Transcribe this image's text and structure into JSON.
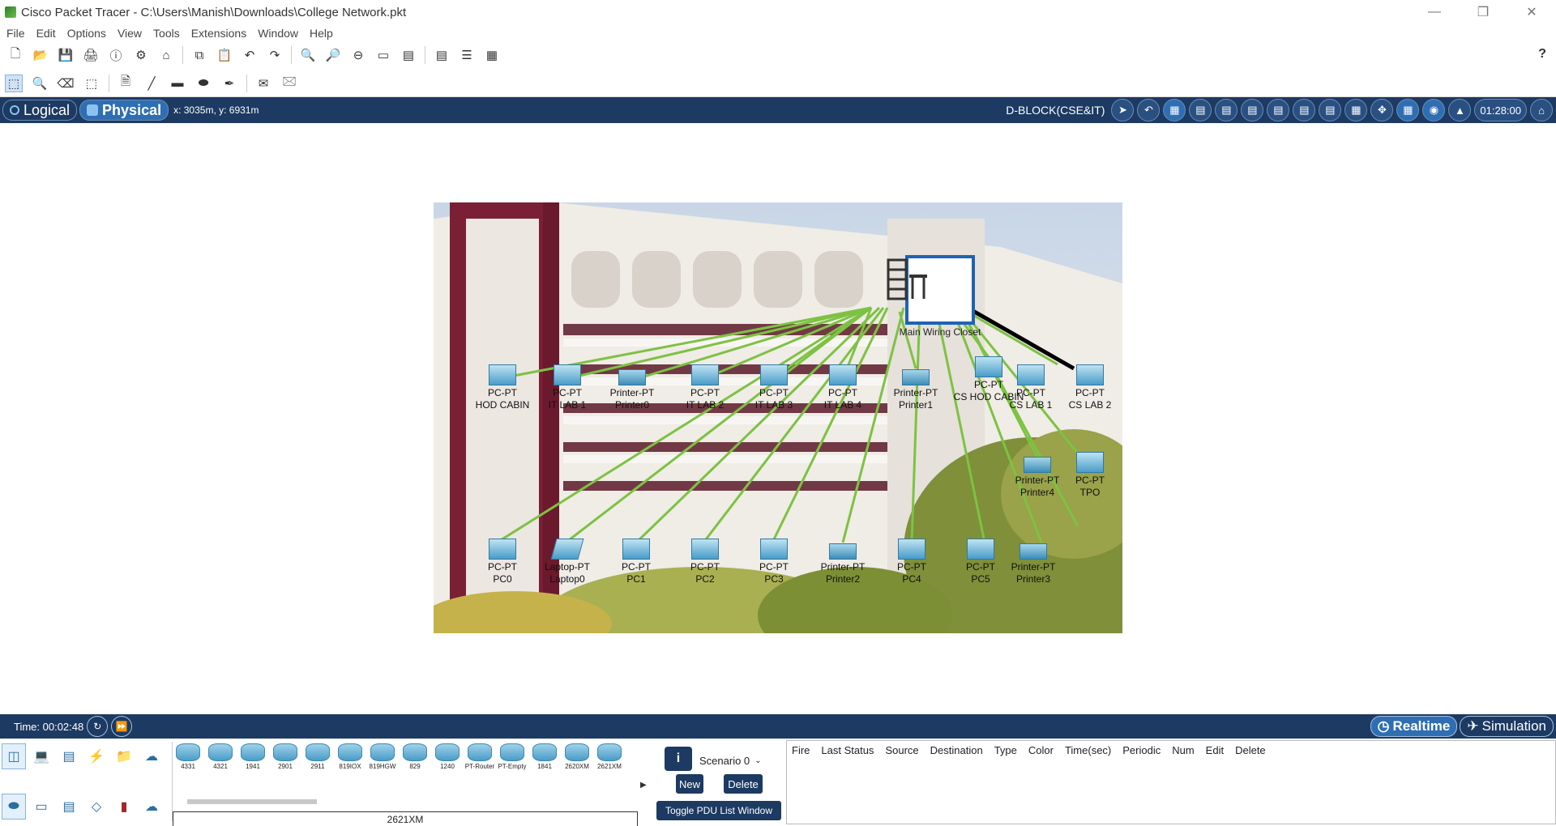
{
  "window": {
    "title": "Cisco Packet Tracer - C:\\Users\\Manish\\Downloads\\College Network.pkt"
  },
  "menu": [
    "File",
    "Edit",
    "Options",
    "View",
    "Tools",
    "Extensions",
    "Window",
    "Help"
  ],
  "toolbar_main": {
    "icons": [
      "new-file-icon",
      "open-icon",
      "save-icon",
      "print-icon",
      "info-icon",
      "wizard-icon",
      "network-info-icon",
      "copy-icon",
      "paste-icon",
      "undo-icon",
      "redo-icon",
      "zoom-in-icon",
      "zoom-reset-icon",
      "zoom-out-icon",
      "drawing-palette-icon",
      "custom-device-icon",
      "notes-icon",
      "cluster-icon",
      "viewport-icon"
    ],
    "help": "?"
  },
  "toolbar_tools": {
    "icons": [
      "select-icon",
      "inspect-icon",
      "delete-icon",
      "resize-icon",
      "note-icon",
      "line-icon",
      "rectangle-icon",
      "ellipse-icon",
      "freeform-icon",
      "add-simple-pdu-icon",
      "add-complex-pdu-icon"
    ]
  },
  "modebar": {
    "logical": "Logical",
    "physical": "Physical",
    "coords": "x: 3035m, y: 6931m",
    "location": "D-BLOCK(CSE&IT)",
    "clock": "01:28:00"
  },
  "canvas": {
    "closet_label": "Main Wiring Closet",
    "devices_top": [
      {
        "type": "PC-PT",
        "name": "HOD CABIN"
      },
      {
        "type": "PC-PT",
        "name": "IT LAB 1"
      },
      {
        "type": "Printer-PT",
        "name": "Printer0"
      },
      {
        "type": "PC-PT",
        "name": "IT LAB 2"
      },
      {
        "type": "PC-PT",
        "name": "IT LAB 3"
      },
      {
        "type": "PC-PT",
        "name": "IT LAB 4"
      },
      {
        "type": "Printer-PT",
        "name": "Printer1"
      },
      {
        "type": "PC-PT",
        "name": "CS HOD CABIN"
      },
      {
        "type": "PC-PT",
        "name": "CS LAB 1"
      },
      {
        "type": "PC-PT",
        "name": "CS LAB 2"
      }
    ],
    "devices_right": [
      {
        "type": "Printer-PT",
        "name": "Printer4"
      },
      {
        "type": "PC-PT",
        "name": "TPO"
      }
    ],
    "devices_bottom": [
      {
        "type": "PC-PT",
        "name": "PC0"
      },
      {
        "type": "Laptop-PT",
        "name": "Laptop0"
      },
      {
        "type": "PC-PT",
        "name": "PC1"
      },
      {
        "type": "PC-PT",
        "name": "PC2"
      },
      {
        "type": "PC-PT",
        "name": "PC3"
      },
      {
        "type": "Printer-PT",
        "name": "Printer2"
      },
      {
        "type": "PC-PT",
        "name": "PC4"
      },
      {
        "type": "PC-PT",
        "name": "PC5"
      },
      {
        "type": "Printer-PT",
        "name": "Printer3"
      }
    ]
  },
  "statusbar": {
    "time": "Time: 00:02:48",
    "realtime": "Realtime",
    "simulation": "Simulation"
  },
  "device_categories": [
    "network-devices",
    "end-devices",
    "components",
    "connections",
    "miscellaneous",
    "multiuser"
  ],
  "device_subcategories": [
    "routers",
    "switches",
    "hubs",
    "wireless",
    "security",
    "wan-emulation"
  ],
  "device_models": [
    "4331",
    "4321",
    "1941",
    "2901",
    "2911",
    "819IOX",
    "819HGW",
    "829",
    "1240",
    "PT-Router",
    "PT-Empty",
    "1841",
    "2620XM",
    "2621XM"
  ],
  "selected_model": "2621XM",
  "pdu": {
    "scenario": "Scenario 0",
    "new": "New",
    "delete": "Delete",
    "toggle": "Toggle PDU List Window",
    "columns": [
      "Fire",
      "Last Status",
      "Source",
      "Destination",
      "Type",
      "Color",
      "Time(sec)",
      "Periodic",
      "Num",
      "Edit",
      "Delete"
    ]
  },
  "colors": {
    "mode_bar": "#1c3a62",
    "active_tab": "#2f6eb3",
    "link": "#7dc243",
    "closet_border": "#1f62b5"
  }
}
